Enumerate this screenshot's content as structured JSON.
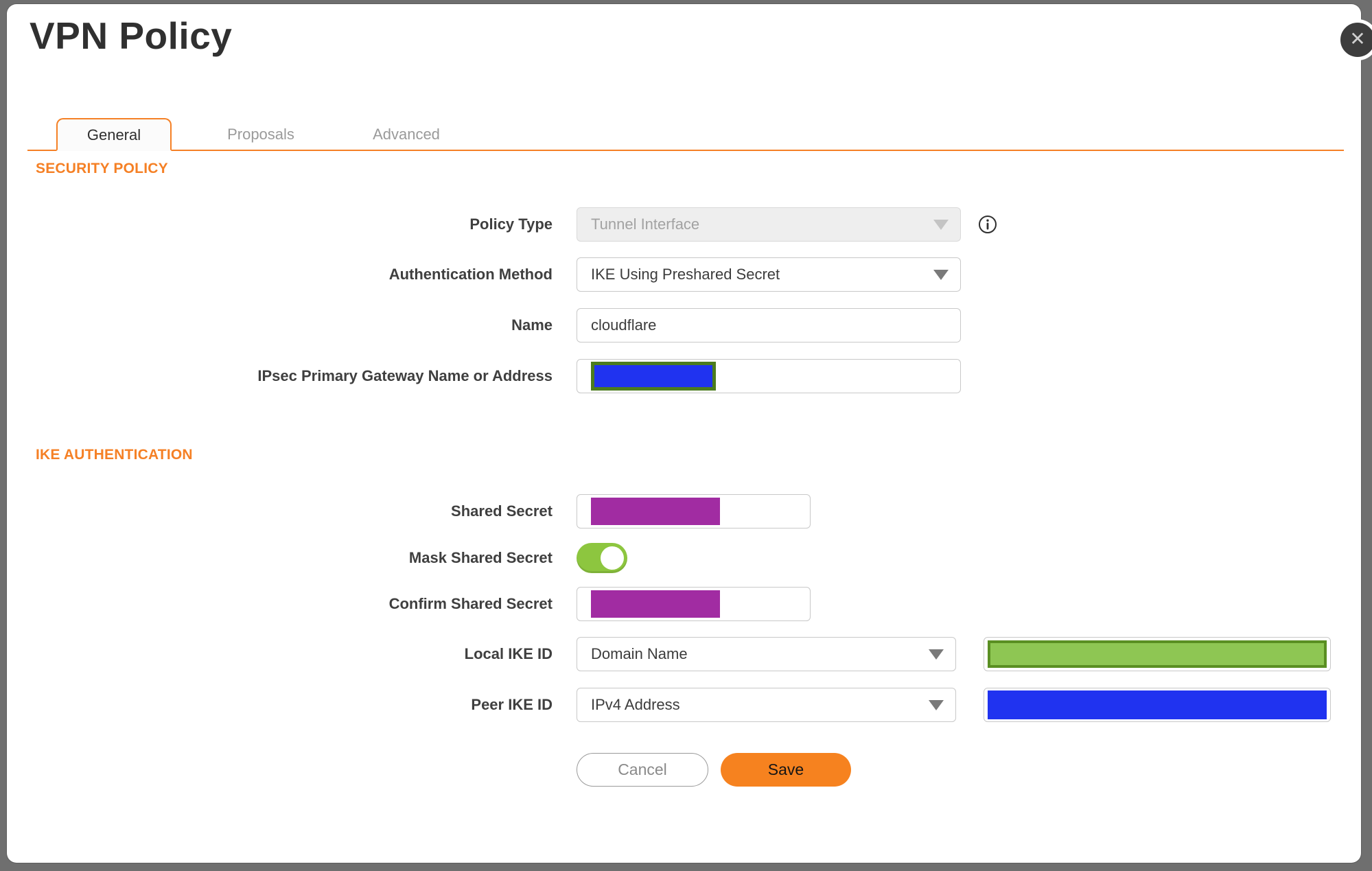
{
  "window": {
    "title": "VPN Policy",
    "close_label": "✕"
  },
  "tabs": [
    {
      "label": "General",
      "active": true
    },
    {
      "label": "Proposals",
      "active": false
    },
    {
      "label": "Advanced",
      "active": false
    }
  ],
  "security_policy": {
    "heading": "SECURITY POLICY",
    "policy_type": {
      "label": "Policy Type",
      "value": "Tunnel Interface",
      "disabled": true
    },
    "authentication_method": {
      "label": "Authentication Method",
      "value": "IKE Using Preshared Secret"
    },
    "name": {
      "label": "Name",
      "value": "cloudflare"
    },
    "gateway": {
      "label": "IPsec Primary Gateway Name or Address",
      "value": "",
      "redacted": true
    }
  },
  "ike_authentication": {
    "heading": "IKE AUTHENTICATION",
    "shared_secret": {
      "label": "Shared Secret",
      "value": "",
      "redacted": true
    },
    "mask_shared_secret": {
      "label": "Mask Shared Secret",
      "state": "on"
    },
    "confirm_shared_secret": {
      "label": "Confirm Shared Secret",
      "value": "",
      "redacted": true
    },
    "local_ike_id": {
      "label": "Local IKE ID",
      "value": "Domain Name",
      "value_redacted": true
    },
    "peer_ike_id": {
      "label": "Peer IKE ID",
      "value": "IPv4 Address",
      "value_redacted": true
    }
  },
  "actions": {
    "cancel": "Cancel",
    "save": "Save"
  },
  "colors": {
    "accent_orange": "#F58025",
    "save_button_orange": "#F6821F",
    "toggle_green": "#8DC63F",
    "redaction_purple": "#A12CA2",
    "redaction_blue": "#2033F0",
    "redaction_green_fill": "#8EC653",
    "redaction_green_border": "#5A8F22",
    "redaction_olive_border": "#4C7C1E",
    "overlay_gray": "#6f6f6f"
  }
}
